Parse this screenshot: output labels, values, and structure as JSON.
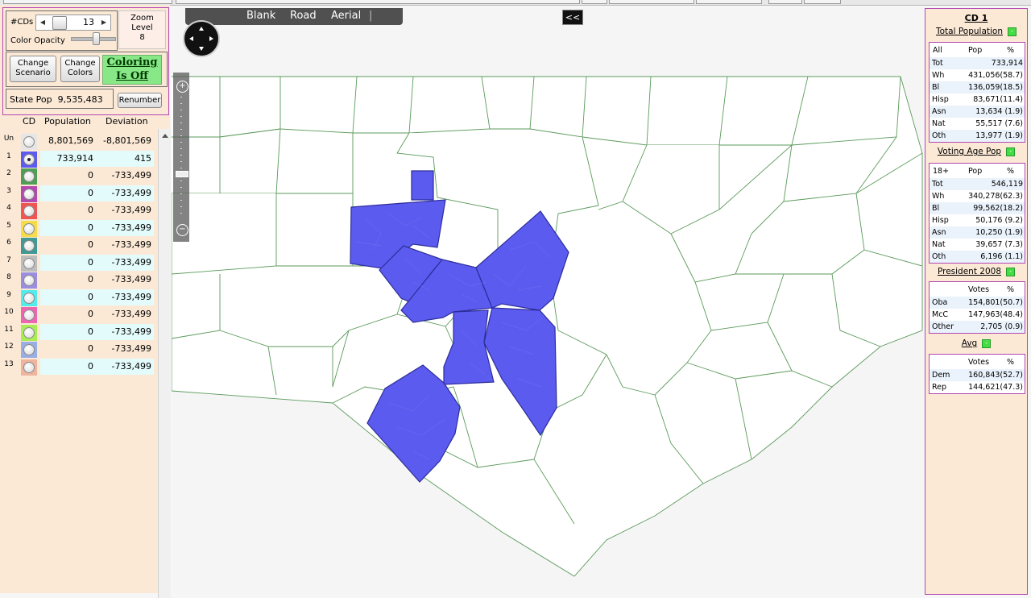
{
  "controls": {
    "cds_label": "#CDs",
    "cds_value": "13",
    "zoom_label_line1": "Zoom",
    "zoom_label_line2": "Level",
    "zoom_value": "8",
    "opacity_label": "Color Opacity",
    "change_scenario_line1": "Change",
    "change_scenario_line2": "Scenario",
    "change_colors_line1": "Change",
    "change_colors_line2": "Colors",
    "coloring_line1": "Coloring",
    "coloring_line2": "Is Off",
    "state_pop_label": "State Pop",
    "state_pop_value": "9,535,483",
    "renumber_label": "Renumber"
  },
  "table": {
    "headers": {
      "cd": "CD",
      "population": "Population",
      "deviation": "Deviation"
    },
    "rows": [
      {
        "cd": "Un",
        "color": "#e6e6e6",
        "population": "8,801,569",
        "deviation": "-8,801,569",
        "band": "#fbe9d6",
        "selected": false
      },
      {
        "cd": "1",
        "color": "#5b5bf0",
        "population": "733,914",
        "deviation": "415",
        "band": "#e4fbfb",
        "selected": true
      },
      {
        "cd": "2",
        "color": "#4e9e56",
        "population": "0",
        "deviation": "-733,499",
        "band": "#fbe9d6",
        "selected": false
      },
      {
        "cd": "3",
        "color": "#b248b0",
        "population": "0",
        "deviation": "-733,499",
        "band": "#e4fbfb",
        "selected": false
      },
      {
        "cd": "4",
        "color": "#f25454",
        "population": "0",
        "deviation": "-733,499",
        "band": "#fbe9d6",
        "selected": false
      },
      {
        "cd": "5",
        "color": "#f5dc4a",
        "population": "0",
        "deviation": "-733,499",
        "band": "#e4fbfb",
        "selected": false
      },
      {
        "cd": "6",
        "color": "#3f9a96",
        "population": "0",
        "deviation": "-733,499",
        "band": "#fbe9d6",
        "selected": false
      },
      {
        "cd": "7",
        "color": "#bdbdbd",
        "population": "0",
        "deviation": "-733,499",
        "band": "#e4fbfb",
        "selected": false
      },
      {
        "cd": "8",
        "color": "#9a8ee0",
        "population": "0",
        "deviation": "-733,499",
        "band": "#fbe9d6",
        "selected": false
      },
      {
        "cd": "9",
        "color": "#52ecec",
        "population": "0",
        "deviation": "-733,499",
        "band": "#e4fbfb",
        "selected": false
      },
      {
        "cd": "10",
        "color": "#ef66b0",
        "population": "0",
        "deviation": "-733,499",
        "band": "#fbe9d6",
        "selected": false
      },
      {
        "cd": "11",
        "color": "#a8ec56",
        "population": "0",
        "deviation": "-733,499",
        "band": "#e4fbfb",
        "selected": false
      },
      {
        "cd": "12",
        "color": "#99aee4",
        "population": "0",
        "deviation": "-733,499",
        "band": "#fbe9d6",
        "selected": false
      },
      {
        "cd": "13",
        "color": "#eeb49e",
        "population": "0",
        "deviation": "-733,499",
        "band": "#e4fbfb",
        "selected": false
      }
    ]
  },
  "map": {
    "tabs": [
      "Blank",
      "Road",
      "Aerial"
    ],
    "collapse_glyph": "<<",
    "district_fill": "#5b5bf0"
  },
  "right": {
    "title": "CD 1",
    "total_pop": {
      "heading": "Total Population",
      "cols": [
        "All",
        "Pop",
        "%"
      ],
      "rows": [
        [
          "Tot",
          "733,914"
        ],
        [
          "Wh",
          "431,056(58.7)"
        ],
        [
          "Bl",
          "136,059(18.5)"
        ],
        [
          "Hisp",
          "83,671(11.4)"
        ],
        [
          "Asn",
          "13,634 (1.9)"
        ],
        [
          "Nat",
          "55,517 (7.6)"
        ],
        [
          "Oth",
          "13,977 (1.9)"
        ]
      ]
    },
    "vap": {
      "heading": "Voting Age Pop",
      "cols": [
        "18+",
        "Pop",
        "%"
      ],
      "rows": [
        [
          "Tot",
          "546,119"
        ],
        [
          "Wh",
          "340,278(62.3)"
        ],
        [
          "Bl",
          "99,562(18.2)"
        ],
        [
          "Hisp",
          "50,176 (9.2)"
        ],
        [
          "Asn",
          "10,250 (1.9)"
        ],
        [
          "Nat",
          "39,657 (7.3)"
        ],
        [
          "Oth",
          "6,196 (1.1)"
        ]
      ]
    },
    "pres": {
      "heading": "President 2008",
      "cols": [
        "",
        "Votes",
        "%"
      ],
      "rows": [
        [
          "Oba",
          "154,801(50.7)"
        ],
        [
          "McC",
          "147,963(48.4)"
        ],
        [
          "Other",
          "2,705 (0.9)"
        ]
      ]
    },
    "avg": {
      "heading": "Avg",
      "cols": [
        "",
        "Votes",
        "%"
      ],
      "rows": [
        [
          "Dem",
          "160,843(52.7)"
        ],
        [
          "Rep",
          "144,621(47.3)"
        ]
      ]
    }
  }
}
